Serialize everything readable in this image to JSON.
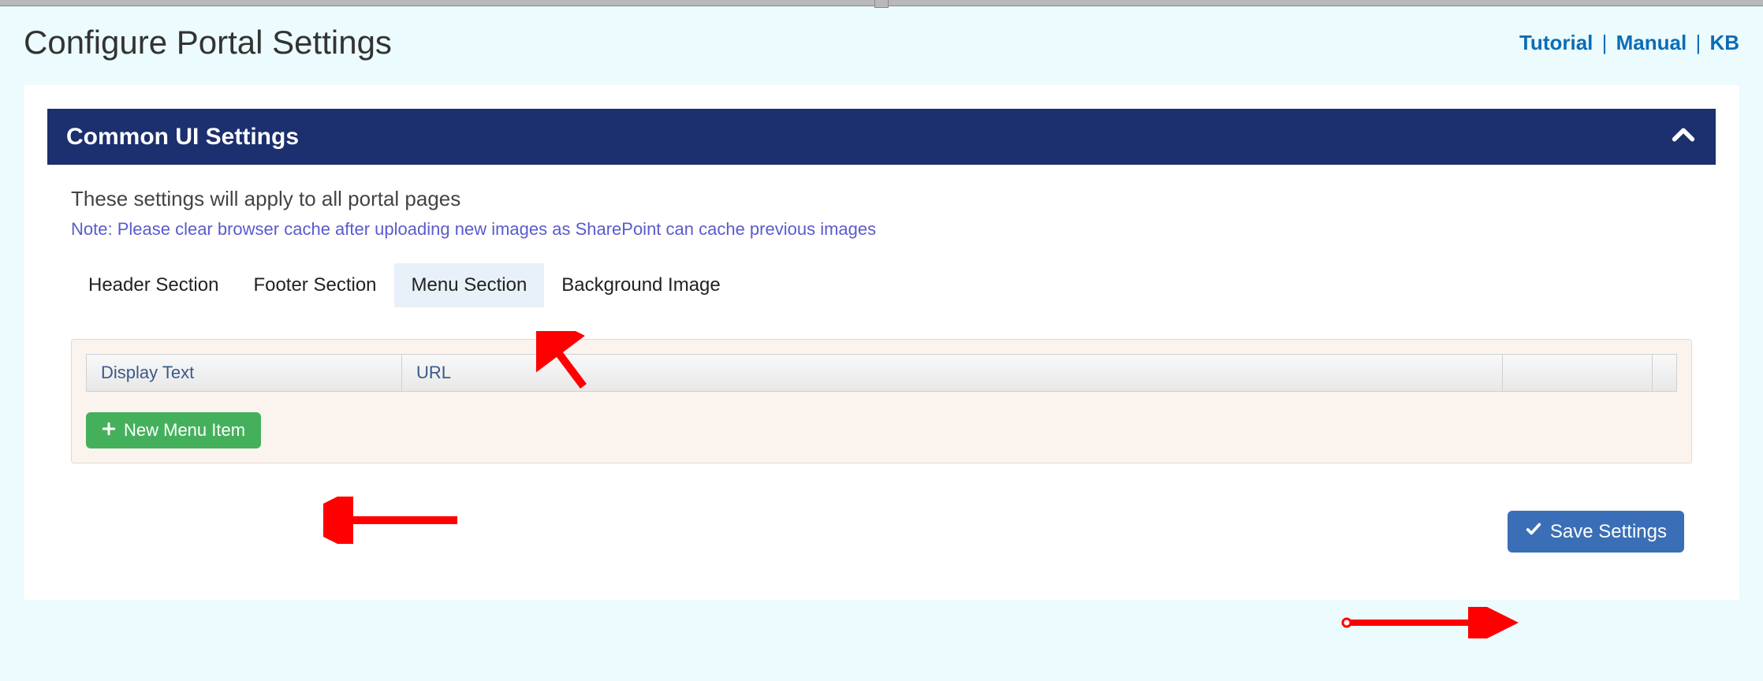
{
  "page": {
    "title": "Configure Portal Settings"
  },
  "help_links": {
    "tutorial": "Tutorial",
    "manual": "Manual",
    "kb": "KB"
  },
  "panel": {
    "title": "Common UI Settings",
    "description": "These settings will apply to all portal pages",
    "note": "Note: Please clear browser cache after uploading new images as SharePoint can cache previous images"
  },
  "tabs": {
    "header": "Header Section",
    "footer": "Footer Section",
    "menu": "Menu Section",
    "background": "Background Image",
    "active": "menu"
  },
  "table": {
    "col_display": "Display Text",
    "col_url": "URL"
  },
  "buttons": {
    "new_item": "New Menu Item",
    "save": "Save Settings"
  }
}
